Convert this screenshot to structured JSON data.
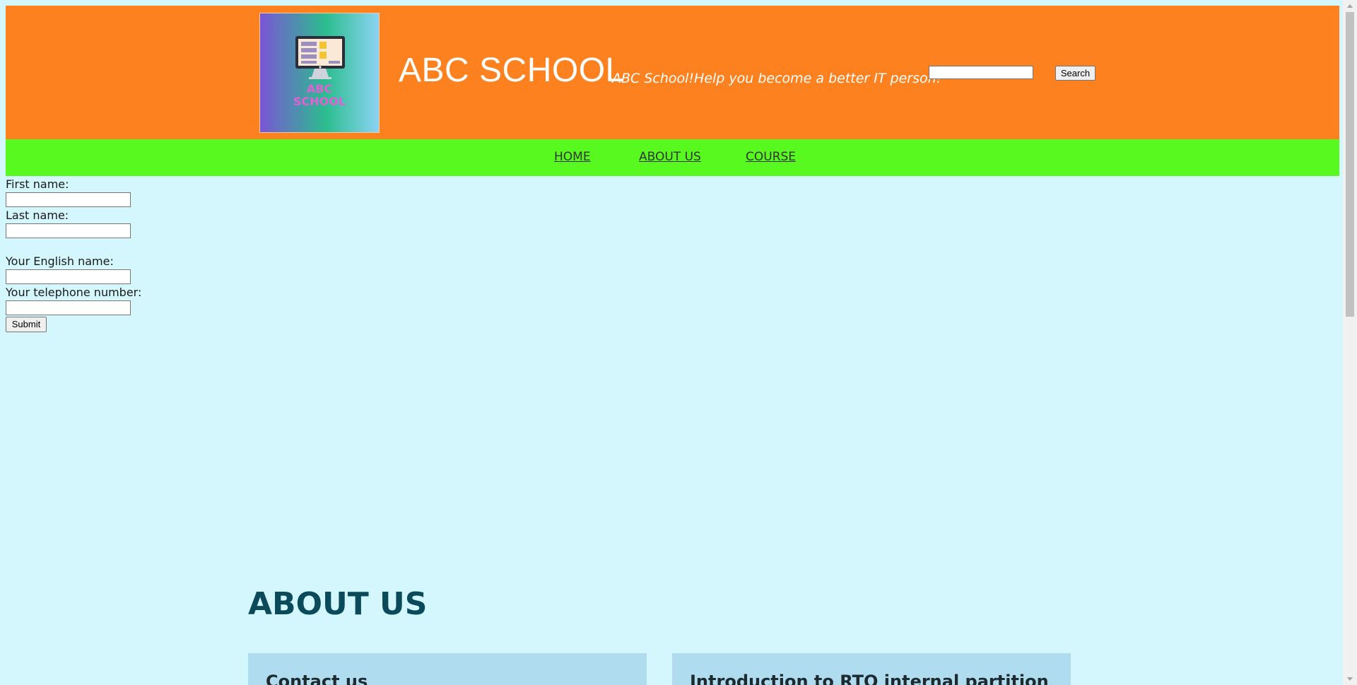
{
  "header": {
    "logo_text": "ABC SCHOOL",
    "site_title": "ABC SCHOOL",
    "slogan": "ABC School!Help you become a better IT person!",
    "search_value": "",
    "search_button": "Search"
  },
  "nav": {
    "items": [
      {
        "label": "HOME"
      },
      {
        "label": "ABOUT US"
      },
      {
        "label": "COURSE"
      }
    ]
  },
  "form": {
    "first_name_label": "First name:",
    "first_name_value": "",
    "last_name_label": "Last name:",
    "last_name_value": "",
    "english_name_label": "Your English name:",
    "english_name_value": "",
    "telephone_label": "Your telephone number:",
    "telephone_value": "",
    "submit_label": "Submit"
  },
  "about": {
    "heading": "ABOUT US",
    "cards": [
      {
        "title": "Contact us"
      },
      {
        "title": "Introduction to RTO internal partition"
      }
    ]
  },
  "colors": {
    "header_bg": "#fd821f",
    "nav_bg": "#58f91f",
    "page_bg": "#d4f6fd",
    "card_bg": "#afdcee",
    "heading_color": "#0b4a5a"
  }
}
